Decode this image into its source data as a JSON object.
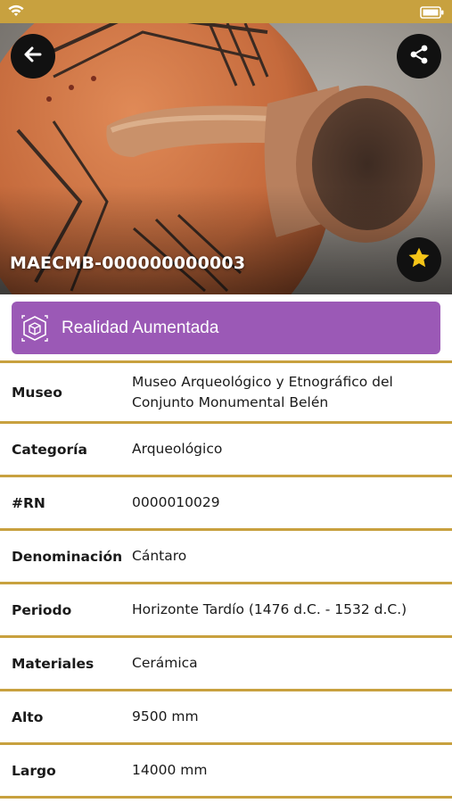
{
  "status_bar": {
    "wifi_icon": "wifi-icon",
    "battery_icon": "battery-icon"
  },
  "hero": {
    "code": "MAECMB-000000000003",
    "back_icon": "arrow-left-icon",
    "share_icon": "share-icon",
    "favorite_icon": "star-icon",
    "favorite_color": "#f5c518"
  },
  "ar_button": {
    "label": "Realidad Aumentada",
    "icon": "augmented-reality-cube-icon",
    "color": "#9b59b6"
  },
  "accent_color": "#c8a13f",
  "details": [
    {
      "key": "Museo",
      "value": "Museo Arqueológico y Etnográfico del Conjunto Monumental Belén"
    },
    {
      "key": "Categoría",
      "value": "Arqueológico"
    },
    {
      "key": "#RN",
      "value": "0000010029"
    },
    {
      "key": "Denominación",
      "value": "Cántaro"
    },
    {
      "key": "Periodo",
      "value": "Horizonte Tardío (1476 d.C. - 1532 d.C.)"
    },
    {
      "key": "Materiales",
      "value": "Cerámica"
    },
    {
      "key": "Alto",
      "value": "9500 mm"
    },
    {
      "key": "Largo",
      "value": "14000 mm"
    }
  ]
}
